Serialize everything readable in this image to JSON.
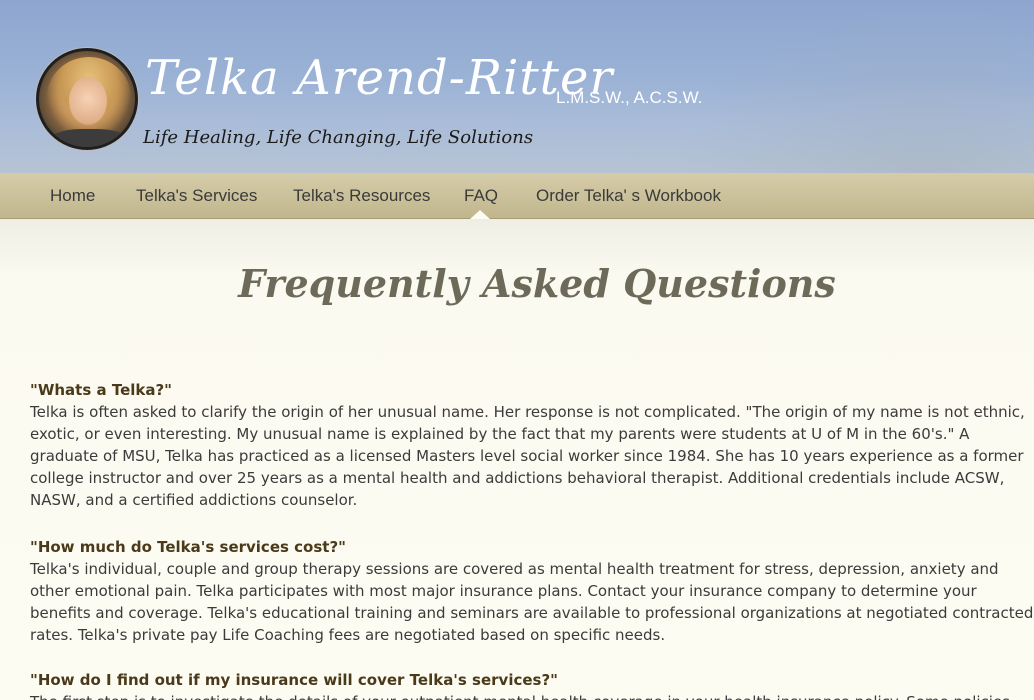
{
  "header": {
    "name": "Telka Arend-Ritter",
    "credentials": "L.M.S.W., A.C.S.W.",
    "tagline": "Life Healing, Life Changing, Life Solutions"
  },
  "nav": {
    "items": [
      {
        "label": "Home"
      },
      {
        "label": "Telka's Services"
      },
      {
        "label": "Telka's Resources"
      },
      {
        "label": "FAQ"
      },
      {
        "label": "Order Telka' s Workbook"
      }
    ],
    "active": "FAQ"
  },
  "page": {
    "title": "Frequently Asked Questions"
  },
  "faqs": [
    {
      "question": "\"Whats a Telka?\"",
      "answer": "Telka is often asked to clarify the origin of her unusual name. Her response is not complicated. \"The origin of my name is not ethnic, exotic, or even interesting. My unusual name is explained by the fact that my parents were students at U of M in the 60's.\" A graduate of MSU, Telka has practiced as a licensed Masters level social worker since 1984. She has 10 years experience as a former college instructor and over 25 years as a mental health and addictions behavioral therapist. Additional credentials include ACSW, NASW, and a certified addictions counselor."
    },
    {
      "question": "\"How much do Telka's services cost?\"",
      "answer": "Telka's individual, couple and group therapy sessions are covered as mental health treatment for stress, depression, anxiety and other emotional pain. Telka participates with most major insurance plans. Contact your insurance company to determine your benefits and coverage. Telka's educational training and seminars are available to professional organizations at negotiated contracted rates. Telka's private pay Life Coaching fees are negotiated based on specific needs."
    },
    {
      "question": "\"How do I find out if my insurance will cover Telka's services?\"",
      "answer": "The first step is to investigate the details of your outpatient mental health coverage in your health insurance policy. Some policies"
    }
  ]
}
